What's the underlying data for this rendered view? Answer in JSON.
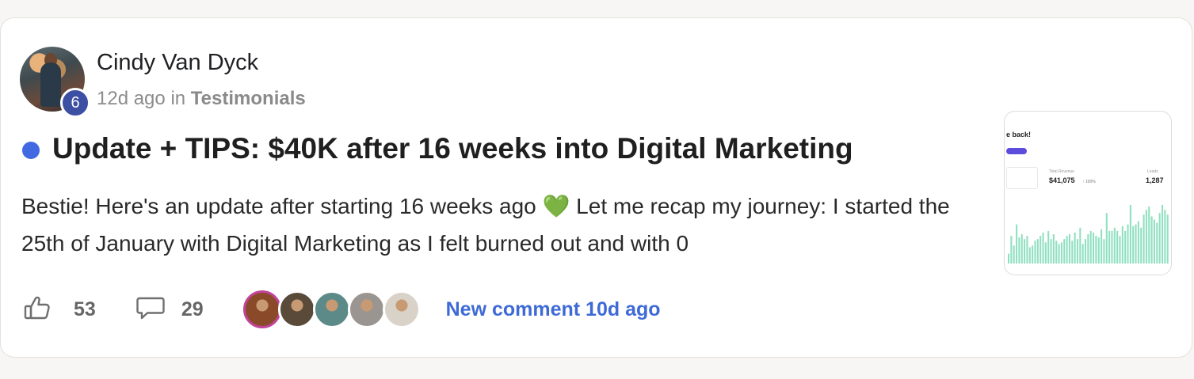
{
  "post": {
    "author": "Cindy Van Dyck",
    "level": "6",
    "time": "12d ago",
    "in_word": "in",
    "category": "Testimonials",
    "title": "Update + TIPS: $40K after 16 weeks into Digital Marketing",
    "excerpt_part1": "Bestie! Here's an update after starting 16 weeks ago ",
    "excerpt_emoji": "💚",
    "excerpt_part2": " Let me recap my journey: I started the 25th of January with Digital Marketing as I felt burned out and with 0"
  },
  "actions": {
    "likes": "53",
    "comments": "29",
    "new_comment": "New comment 10d ago"
  },
  "commenters": [
    {
      "name": "commenter-1",
      "color": "#8a4a2a"
    },
    {
      "name": "commenter-2",
      "color": "#5a4a3a"
    },
    {
      "name": "commenter-3",
      "color": "#5b8a88"
    },
    {
      "name": "commenter-4",
      "color": "#9a9590"
    },
    {
      "name": "commenter-5",
      "color": "#d9d2c8"
    }
  ],
  "thumbnail": {
    "heading": "e back!",
    "total_revenue_label": "Total Revenue",
    "total_revenue": "$41,075",
    "revenue_change": "↑ 100%",
    "leads_label": "Leads",
    "leads": "1,287",
    "bars": [
      12,
      34,
      22,
      48,
      32,
      36,
      30,
      34,
      20,
      22,
      28,
      30,
      34,
      38,
      26,
      40,
      30,
      36,
      28,
      24,
      26,
      30,
      34,
      36,
      28,
      38,
      30,
      44,
      24,
      30,
      36,
      40,
      38,
      34,
      32,
      42,
      30,
      62,
      40,
      40,
      44,
      40,
      34,
      46,
      40,
      48,
      72,
      46,
      48,
      52,
      44,
      60,
      66,
      70,
      58,
      54,
      50,
      62,
      72,
      66,
      60
    ],
    "bar_color": "#8fe0c0"
  },
  "colors": {
    "unread_dot": "#4169e1",
    "link": "#3e6ad6",
    "level_badge": "#3c4fa3"
  }
}
